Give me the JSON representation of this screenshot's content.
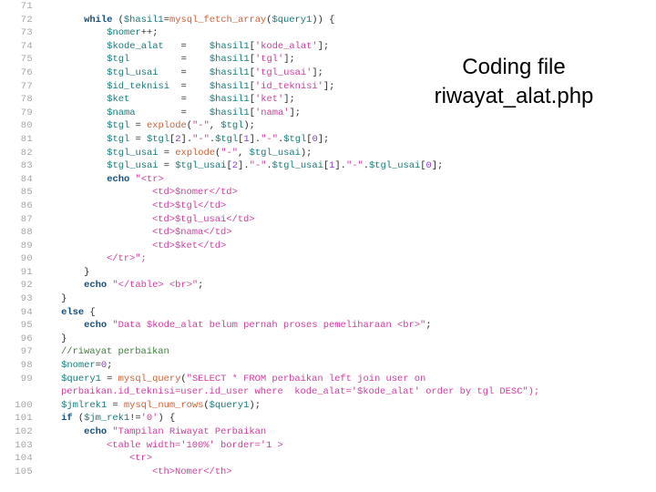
{
  "slide": {
    "background_color": "#ffffff",
    "caption": {
      "line1": "Coding file",
      "line2": "riwayat_alat.php",
      "color": "#000000"
    }
  },
  "colors": {
    "gutter": "#a6a6a6",
    "variable": "#1a7a7a",
    "keyword": "#14507d",
    "string": "#cc3fa0",
    "function": "#c8643c",
    "number": "#8844bb",
    "comment": "#3f7f3f",
    "plain": "#2b2b2b"
  },
  "code": {
    "language": "php",
    "first_line_number": 71,
    "last_line_number": 105,
    "lines": [
      {
        "num": "71",
        "text": ""
      },
      {
        "num": "72",
        "text": "        while ($hasil1=mysql_fetch_array($query1)) {"
      },
      {
        "num": "73",
        "text": "            $nomer++;"
      },
      {
        "num": "74",
        "text": "            $kode_alat   =    $hasil1['kode_alat'];"
      },
      {
        "num": "75",
        "text": "            $tgl         =    $hasil1['tgl'];"
      },
      {
        "num": "76",
        "text": "            $tgl_usai    =    $hasil1['tgl_usai'];"
      },
      {
        "num": "77",
        "text": "            $id_teknisi  =    $hasil1['id_teknisi'];"
      },
      {
        "num": "78",
        "text": "            $ket         =    $hasil1['ket'];"
      },
      {
        "num": "79",
        "text": "            $nama        =    $hasil1['nama'];"
      },
      {
        "num": "80",
        "text": "            $tgl = explode(\"-\", $tgl);"
      },
      {
        "num": "81",
        "text": "            $tgl = $tgl[2].\"-\".$tgl[1].\"-\".$tgl[0];"
      },
      {
        "num": "82",
        "text": "            $tgl_usai = explode(\"-\", $tgl_usai);"
      },
      {
        "num": "83",
        "text": "            $tgl_usai = $tgl_usai[2].\"-\".$tgl_usai[1].\"-\".$tgl_usai[0];"
      },
      {
        "num": "84",
        "text": "            echo \"<tr>"
      },
      {
        "num": "85",
        "text": "                    <td>$nomer</td>"
      },
      {
        "num": "86",
        "text": "                    <td>$tgl</td>"
      },
      {
        "num": "87",
        "text": "                    <td>$tgl_usai</td>"
      },
      {
        "num": "88",
        "text": "                    <td>$nama</td>"
      },
      {
        "num": "89",
        "text": "                    <td>$ket</td>"
      },
      {
        "num": "90",
        "text": "            </tr>\";"
      },
      {
        "num": "91",
        "text": "        }"
      },
      {
        "num": "92",
        "text": "        echo \"</table> <br>\";"
      },
      {
        "num": "93",
        "text": "    }"
      },
      {
        "num": "94",
        "text": "    else {"
      },
      {
        "num": "95",
        "text": "        echo \"Data $kode_alat belum pernah proses pemeliharaan <br>\";"
      },
      {
        "num": "96",
        "text": "    }"
      },
      {
        "num": "97",
        "text": "    //riwayat perbaikan"
      },
      {
        "num": "98",
        "text": "    $nomer=0;"
      },
      {
        "num": "99",
        "text": "    $query1 = mysql_query(\"SELECT * FROM perbaikan left join user on"
      },
      {
        "num": "",
        "text": "    perbaikan.id_teknisi=user.id_user where  kode_alat='$kode_alat' order by tgl DESC\");"
      },
      {
        "num": "100",
        "text": "    $jmlrek1 = mysql_num_rows($query1);"
      },
      {
        "num": "101",
        "text": "    if ($jm_rek1!='0') {"
      },
      {
        "num": "102",
        "text": "        echo \"Tampilan Riwayat Perbaikan"
      },
      {
        "num": "103",
        "text": "            <table width='100%' border='1 >"
      },
      {
        "num": "104",
        "text": "                <tr>"
      },
      {
        "num": "105",
        "text": "                    <th>Nomer</th>"
      }
    ]
  }
}
